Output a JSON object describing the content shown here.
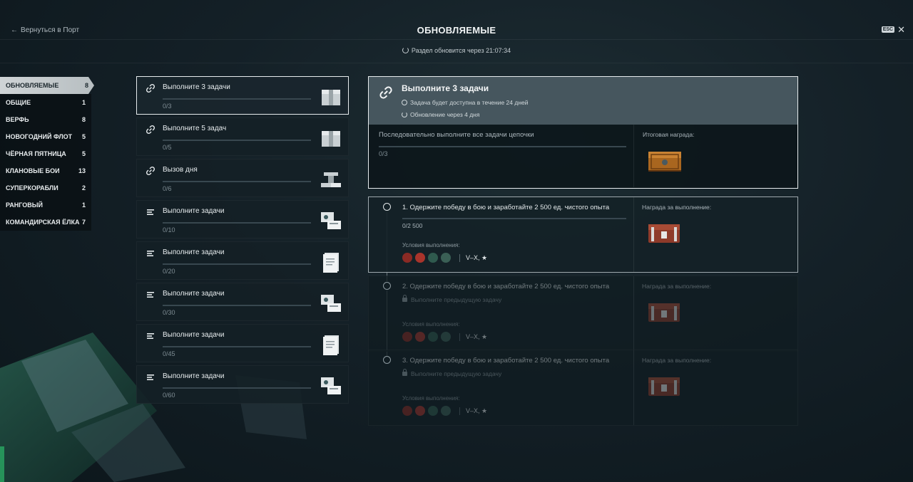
{
  "header": {
    "back_label": "Вернуться в Порт",
    "title": "ОБНОВЛЯЕМЫЕ",
    "esc_label": "ESC",
    "refresh_text": "Раздел обновится через 21:07:34"
  },
  "sidebar": {
    "items": [
      {
        "label": "ОБНОВЛЯЕМЫЕ",
        "count": "8"
      },
      {
        "label": "ОБЩИЕ",
        "count": "1"
      },
      {
        "label": "ВЕРФЬ",
        "count": "8"
      },
      {
        "label": "НОВОГОДНИЙ ФЛОТ",
        "count": "5"
      },
      {
        "label": "ЧЁРНАЯ ПЯТНИЦА",
        "count": "5"
      },
      {
        "label": "КЛАНОВЫЕ БОИ",
        "count": "13"
      },
      {
        "label": "СУПЕРКОРАБЛИ",
        "count": "2"
      },
      {
        "label": "РАНГОВЫЙ",
        "count": "1"
      },
      {
        "label": "КОМАНДИРСКАЯ ЁЛКА",
        "count": "7"
      }
    ]
  },
  "missions": [
    {
      "title": "Выполните 3 задачи",
      "progress": "0/3",
      "icon": "chain-icon",
      "thumb": "crate"
    },
    {
      "title": "Выполните 5 задач",
      "progress": "0/5",
      "icon": "chain-icon",
      "thumb": "crate"
    },
    {
      "title": "Вызов дня",
      "progress": "0/6",
      "icon": "chain-icon",
      "thumb": "metal"
    },
    {
      "title": "Выполните задачи",
      "progress": "0/10",
      "icon": "list-icon",
      "thumb": "cards"
    },
    {
      "title": "Выполните задачи",
      "progress": "0/20",
      "icon": "list-icon",
      "thumb": "doc"
    },
    {
      "title": "Выполните задачи",
      "progress": "0/30",
      "icon": "list-icon",
      "thumb": "cards"
    },
    {
      "title": "Выполните задачи",
      "progress": "0/45",
      "icon": "list-icon",
      "thumb": "doc"
    },
    {
      "title": "Выполните задачи",
      "progress": "0/60",
      "icon": "list-icon",
      "thumb": "cards"
    }
  ],
  "detail": {
    "title": "Выполните 3 задачи",
    "available": "Задача будет доступна в течение 24 дней",
    "update": "Обновление через 4 дня",
    "chain_label": "Последовательно выполните все задачи цепочки",
    "progress": "0/3",
    "final_reward_label": "Итоговая награда:"
  },
  "steps": [
    {
      "title": "1. Одержите победу в бою и заработайте 2 500 ед. чистого опыта",
      "sub": "0/2 500",
      "conditions_label": "Условия выполнения:",
      "tier": "V–X, ★",
      "reward_label": "Награда за выполнение:"
    },
    {
      "title": "2. Одержите победу в бою и заработайте 2 500 ед. чистого опыта",
      "sub": "Выполните предыдущую задачу",
      "conditions_label": "Условия выполнения:",
      "tier": "V–X, ★",
      "reward_label": "Награда за выполнение:"
    },
    {
      "title": "3. Одержите победу в бою и заработайте 2 500 ед. чистого опыта",
      "sub": "Выполните предыдущую задачу",
      "conditions_label": "Условия выполнения:",
      "tier": "V–X, ★",
      "reward_label": "Награда за выполнение:"
    }
  ],
  "colors": {
    "accent": "#e7ecee",
    "header_panel": "#46565e",
    "background": "#142027"
  }
}
